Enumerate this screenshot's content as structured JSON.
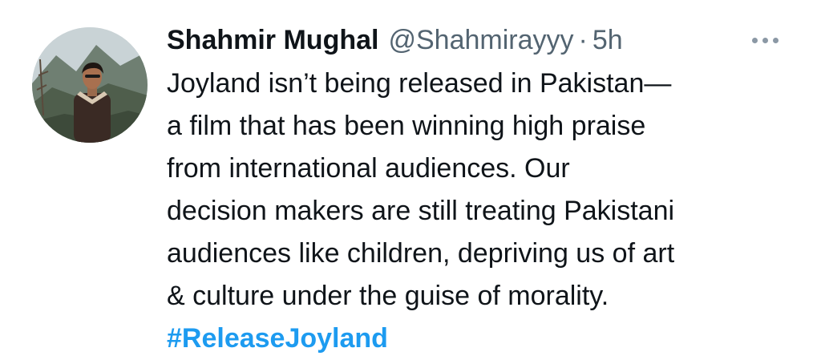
{
  "tweet": {
    "author": {
      "display_name": "Shahmir Mughal",
      "handle": "@Shahmirayyy",
      "separator": "·",
      "time": "5h"
    },
    "more_icon": "more-horizontal-icon",
    "text_lines": [
      "Joyland isn’t being released in Pakistan—",
      "a film that has been winning high praise",
      "from international audiences. Our",
      "decision makers are still treating Pakistani",
      "audiences like children, depriving us of art",
      "& culture under the guise of morality."
    ],
    "hashtag": "#ReleaseJoyland"
  },
  "colors": {
    "text": "#0f1419",
    "secondary": "#536471",
    "link": "#1d9bf0",
    "background": "#ffffff"
  }
}
